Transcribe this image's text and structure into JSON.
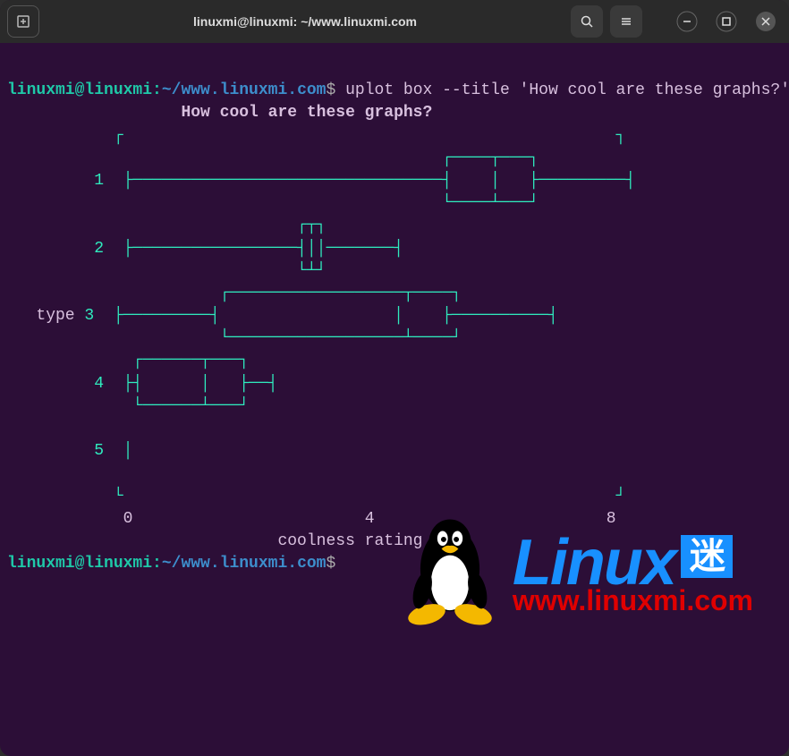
{
  "titlebar": {
    "title": "linuxmi@linuxmi: ~/www.linuxmi.com"
  },
  "prompt": {
    "user": "linuxmi@linuxmi",
    "sep": ":",
    "path": "~/www.linuxmi.com",
    "dollar": "$"
  },
  "command": "uplot box --title 'How cool are these graphs?' --xlabel 'coolness rating' --ylabel 'type' IRIStsv.tsv",
  "chart_data": {
    "type": "boxplot",
    "title": "How cool are these graphs?",
    "xlabel": "coolness rating",
    "ylabel": "type",
    "x_ticks": [
      0,
      4,
      8
    ],
    "xlim": [
      0,
      8
    ],
    "categories": [
      "1",
      "2",
      "3",
      "4",
      "5"
    ],
    "series": [
      {
        "name": "1",
        "min": 0.1,
        "q1": 5.0,
        "median": 5.6,
        "q3": 6.2,
        "max": 7.9
      },
      {
        "name": "2",
        "min": 0.1,
        "q1": 2.8,
        "median": 3.0,
        "q3": 3.0,
        "max": 4.5
      },
      {
        "name": "3",
        "min": 0.1,
        "q1": 1.5,
        "median": 4.2,
        "q3": 5.0,
        "max": 6.8
      },
      {
        "name": "4",
        "min": 0.1,
        "q1": 0.2,
        "median": 1.2,
        "q3": 1.7,
        "max": 2.3
      },
      {
        "name": "5",
        "min": 0.1,
        "q1": 0.1,
        "median": 0.1,
        "q3": 0.1,
        "max": 0.1
      }
    ]
  },
  "watermark": {
    "brand": "Linu",
    "brand_x": "x",
    "suffix": "迷",
    "url": "www.linuxmi.com"
  }
}
